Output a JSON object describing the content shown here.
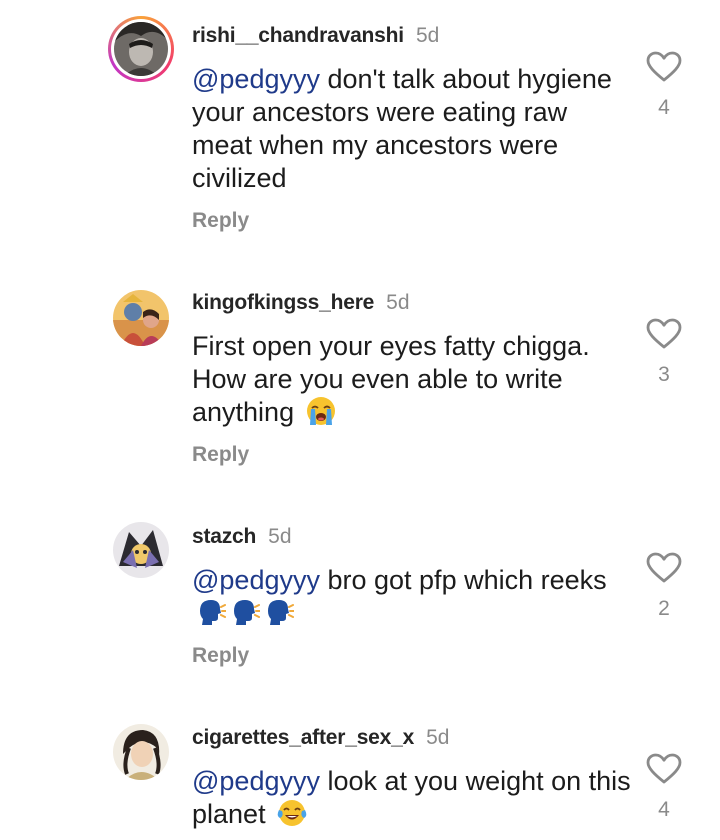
{
  "comments": [
    {
      "username": "rishi__chandravanshi",
      "time": "5d",
      "mention": "@pedgyyy",
      "text": " don't talk about hygiene your ancestors were eating raw meat when my ancestors were civilized",
      "reply_label": "Reply",
      "like_count": "4",
      "has_story_ring": true
    },
    {
      "username": "kingofkingss_here",
      "time": "5d",
      "mention": "",
      "text": "First open your eyes fatty chigga. How are you even able to write anything",
      "emojis": [
        "loudly-crying-face"
      ],
      "reply_label": "Reply",
      "like_count": "3"
    },
    {
      "username": "stazch",
      "time": "5d",
      "mention": "@pedgyyy",
      "text": " bro got pfp which reeks",
      "emojis": [
        "speaking-head",
        "speaking-head",
        "speaking-head"
      ],
      "reply_label": "Reply",
      "like_count": "2"
    },
    {
      "username": "cigarettes_after_sex_x",
      "time": "5d",
      "mention": "@pedgyyy",
      "text": " look at you weight on this planet",
      "emojis": [
        "face-with-tears-of-joy"
      ],
      "like_count": "4"
    }
  ],
  "colors": {
    "mention": "#1f3a8a",
    "muted": "#8a8a8a",
    "story_ring": [
      "#f9a23a",
      "#f23b6b",
      "#c236c6"
    ]
  }
}
